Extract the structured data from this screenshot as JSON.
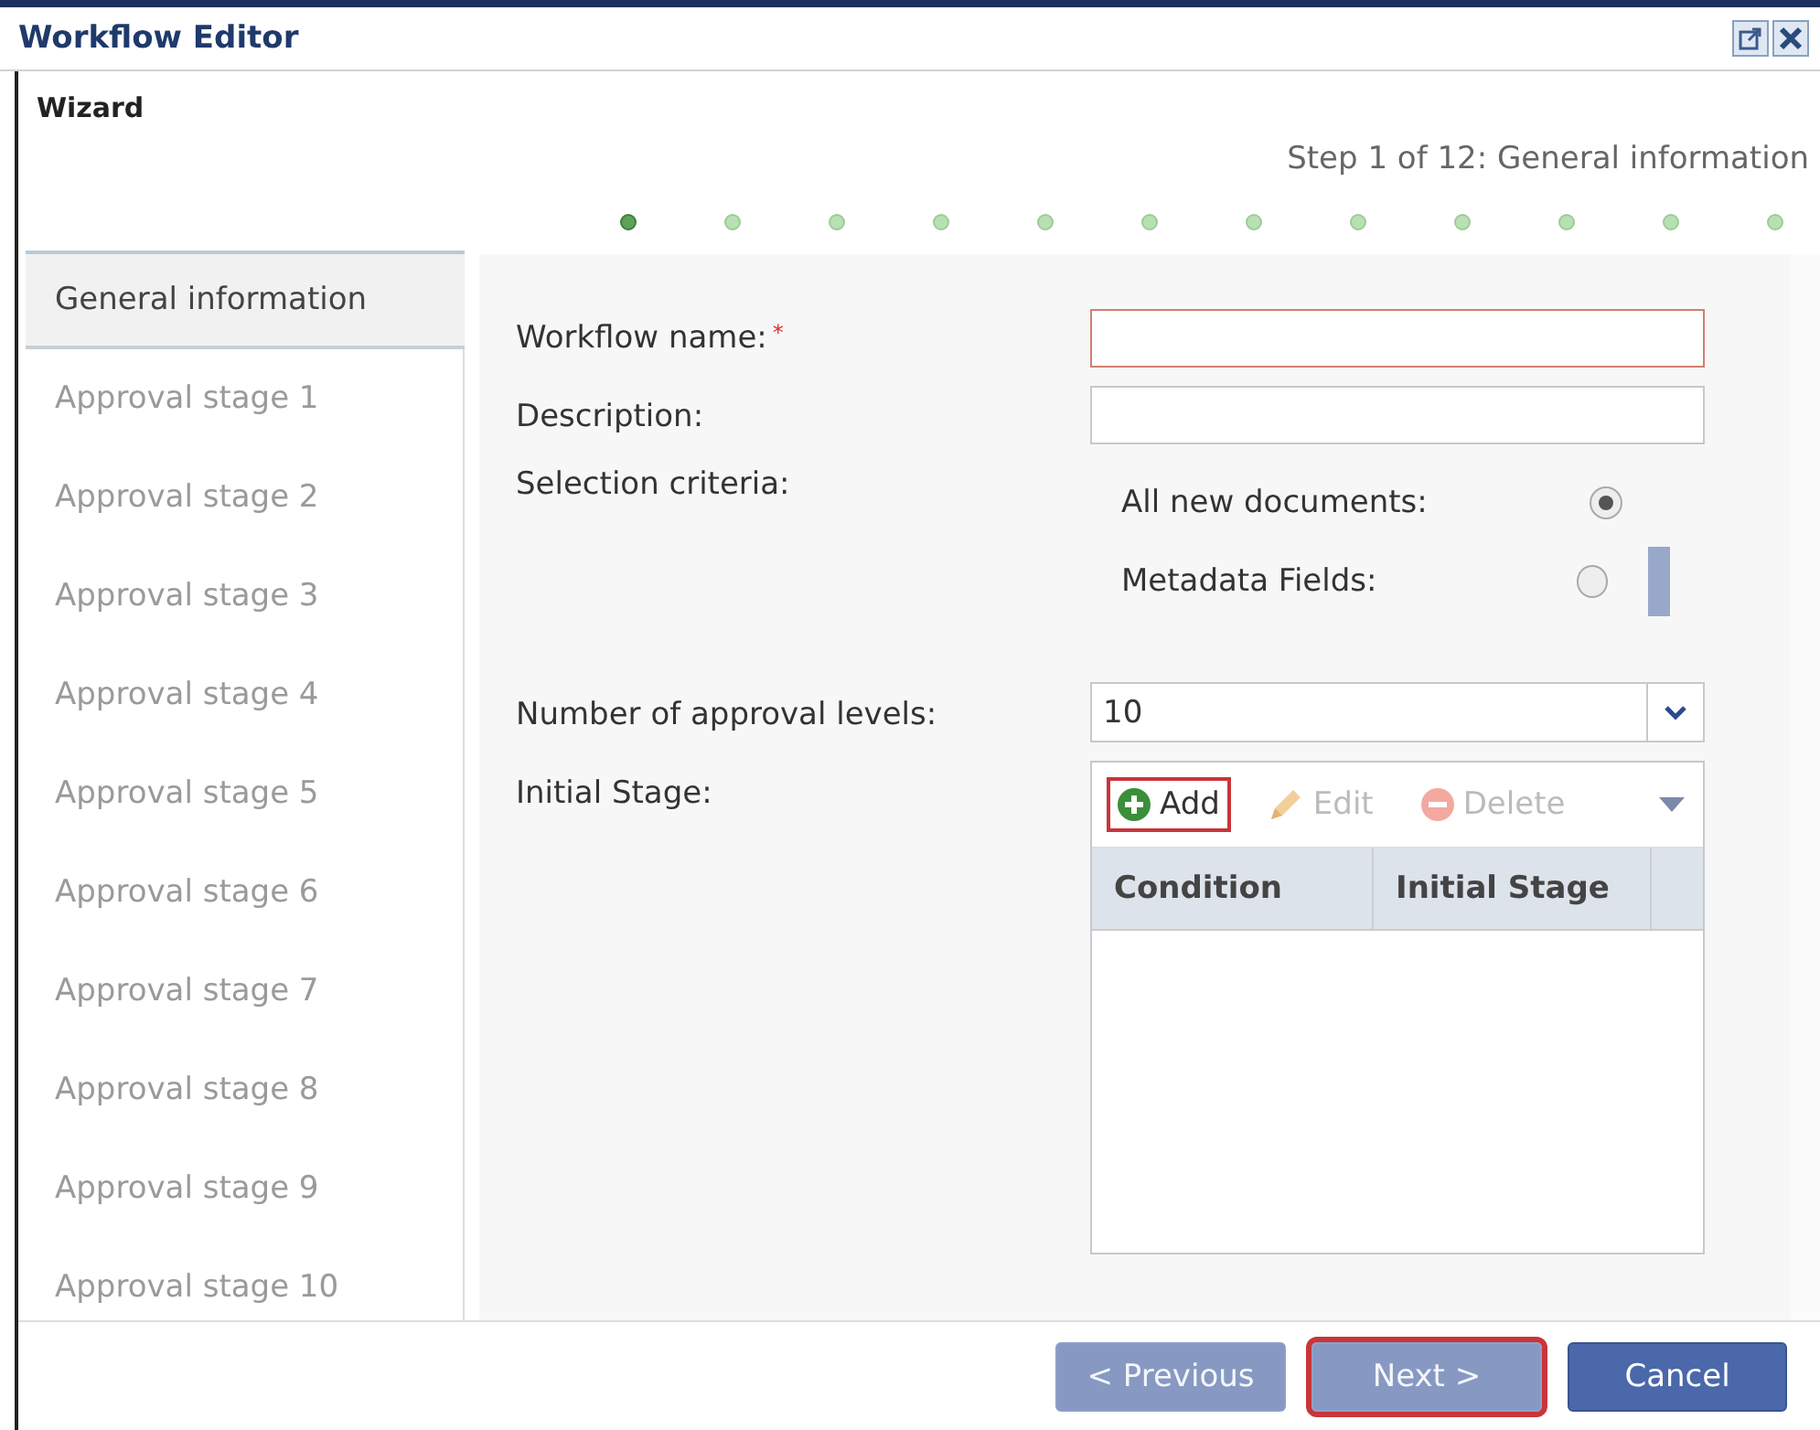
{
  "window": {
    "title": "Workflow Editor"
  },
  "wizard": {
    "title": "Wizard",
    "step_text": "Step 1 of 12: General information",
    "steps": [
      {
        "selected": true
      },
      {
        "selected": false
      },
      {
        "selected": false
      },
      {
        "selected": false
      },
      {
        "selected": false
      },
      {
        "selected": false
      },
      {
        "selected": false
      },
      {
        "selected": false
      },
      {
        "selected": false
      },
      {
        "selected": false
      },
      {
        "selected": false
      },
      {
        "selected": false
      }
    ]
  },
  "sidebar": {
    "items": [
      {
        "label": "General information",
        "selected": true
      },
      {
        "label": "Approval stage 1",
        "selected": false
      },
      {
        "label": "Approval stage 2",
        "selected": false
      },
      {
        "label": "Approval stage 3",
        "selected": false
      },
      {
        "label": "Approval stage 4",
        "selected": false
      },
      {
        "label": "Approval stage 5",
        "selected": false
      },
      {
        "label": "Approval stage 6",
        "selected": false
      },
      {
        "label": "Approval stage 7",
        "selected": false
      },
      {
        "label": "Approval stage 8",
        "selected": false
      },
      {
        "label": "Approval stage 9",
        "selected": false
      },
      {
        "label": "Approval stage 10",
        "selected": false
      }
    ]
  },
  "form": {
    "workflow_name": {
      "label": "Workflow name:",
      "required_mark": "*",
      "invalid": true
    },
    "description": {
      "label": "Description:"
    },
    "selection_criteria": {
      "label": "Selection criteria:",
      "options": [
        {
          "label": "All new documents:",
          "selected": true
        },
        {
          "label": "Metadata Fields:",
          "selected": false
        }
      ]
    },
    "approval_levels": {
      "label": "Number of approval levels:",
      "value": "10"
    },
    "initial_stage": {
      "label": "Initial Stage:",
      "toolbar": [
        {
          "kind": "add",
          "label": "Add",
          "disabled": false,
          "highlighted": true
        },
        {
          "kind": "edit",
          "label": "Edit",
          "disabled": true,
          "highlighted": false
        },
        {
          "kind": "delete",
          "label": "Delete",
          "disabled": true,
          "highlighted": false
        }
      ],
      "columns": [
        "Condition",
        "Initial Stage"
      ]
    }
  },
  "footer": {
    "buttons": [
      {
        "kind": "secondary",
        "label": "< Previous",
        "disabled": true,
        "highlighted": false
      },
      {
        "kind": "secondary",
        "label": "Next >",
        "disabled": true,
        "highlighted": true
      },
      {
        "kind": "primary",
        "label": "Cancel",
        "disabled": false,
        "highlighted": false
      }
    ]
  }
}
